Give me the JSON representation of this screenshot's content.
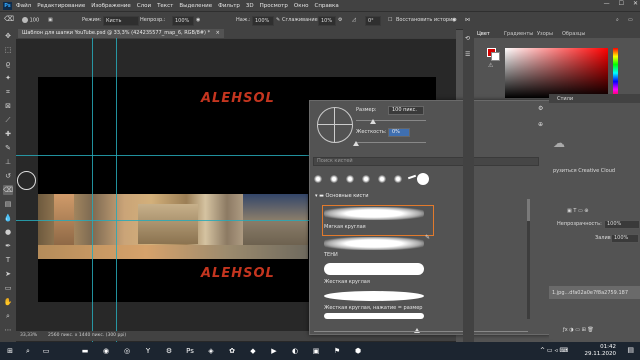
{
  "menu": {
    "app_logo": "Ps",
    "items": [
      "Файл",
      "Редактирование",
      "Изображение",
      "Слои",
      "Текст",
      "Выделение",
      "Фильтр",
      "3D",
      "Просмотр",
      "Окно",
      "Справка"
    ],
    "window_controls": [
      "—",
      "☐",
      "✕"
    ]
  },
  "options": {
    "brush_size": "100",
    "mode_label": "Режим:",
    "mode_value": "Кисть",
    "opacity_label": "Непрозр.:",
    "opacity_value": "100%",
    "flow_label": "Наж.:",
    "flow_value": "100%",
    "smoothing_label": "Сглаживание:",
    "smoothing_value": "10%",
    "angle_value": "0°",
    "erase_history_label": "Восстановить историю"
  },
  "document": {
    "tab_title": "Шаблон для шапки YouTube.psd @ 33,3% (424235577_map_6, RGB/8#) *",
    "logo_text_top": "ALEHSOL",
    "logo_text_bottom": "ALEHSOL"
  },
  "status": {
    "zoom": "33,33%",
    "doc_size": "2560 пикс. x 1440 пикс. (300 ppi)"
  },
  "brush_popup": {
    "size_label": "Размер:",
    "size_value": "100 пикс.",
    "hardness_label": "Жесткость:",
    "hardness_value": "0%",
    "search_placeholder": "Поиск кистей",
    "folder_label": "Основные кисти",
    "brushes": [
      {
        "name": "Мягкая круглая",
        "soft": true,
        "selected": true
      },
      {
        "name": "ТЕНИ",
        "soft": true,
        "selected": false
      },
      {
        "name": "Жесткая круглая",
        "soft": false,
        "selected": false
      },
      {
        "name": "Жесткая круглая, нажатие = размер",
        "soft": false,
        "selected": false
      }
    ]
  },
  "color_panel": {
    "tabs": [
      "Цвет",
      "Градиенты",
      "Узоры",
      "Образцы"
    ],
    "foreground": "#d40000",
    "background": "#ffffff"
  },
  "layers_panel": {
    "tab_label": "Стили",
    "cc_text": "рузиться Creative Cloud",
    "opacity_label": "Непрозрачность:",
    "opacity_value": "100%",
    "fill_label": "Заливка:",
    "fill_value": "100%",
    "layer_name": "1.jpg...dfa02a0e7f8a2759.187"
  },
  "taskbar": {
    "time": "01:42",
    "date": "29.11.2020"
  }
}
